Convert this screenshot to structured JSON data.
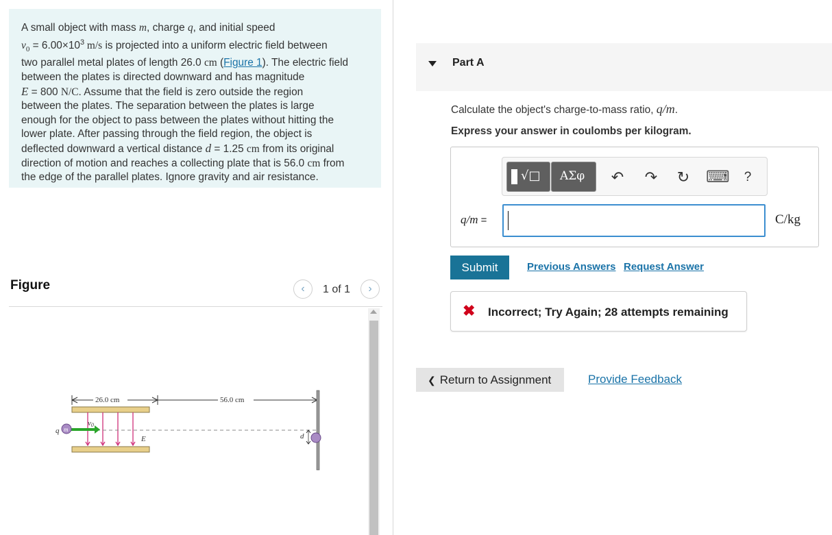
{
  "problem": {
    "line1_a": "A small object with mass ",
    "m": "m",
    "line1_b": ", charge ",
    "q": "q",
    "line1_c": ", and initial speed",
    "v0": "v",
    "v0_sub": "0",
    "line2_a": " = 6.00×10",
    "line2_exp": "3",
    "line2_unit": " m/s",
    "line2_b": " is projected into a uniform electric field between",
    "line3_a": "two parallel metal plates of length 26.0 ",
    "cm": "cm",
    "line3_b": " (",
    "figure_link": "Figure 1",
    "line3_c": "). The electric field",
    "line4": "between the plates is directed downward and has magnitude",
    "E": "E",
    "line5_a": " = 800 ",
    "line5_unit": "N/C",
    "line5_b": ". Assume that the field is zero outside the region",
    "line6": "between the plates. The separation between the plates is large",
    "line7": "enough for the object to pass between the plates without hitting the",
    "line8": "lower plate. After passing through the field region, the object is",
    "line9_a": "deflected downward a vertical distance ",
    "d": "d",
    "line9_b": " = 1.25 ",
    "line9_c": " from its original",
    "line10_a": "direction of motion and reaches a collecting plate that is 56.0 ",
    "line10_b": " from",
    "line11": "the edge of the parallel plates. Ignore gravity and air resistance."
  },
  "figure": {
    "title": "Figure",
    "prev_icon": "‹",
    "next_icon": "›",
    "pager": "1 of 1",
    "label_26": "26.0 cm",
    "label_56": "56.0 cm",
    "label_v0": "v",
    "label_v0_sub": "0",
    "label_q": "q",
    "label_m": "m",
    "label_E": "E",
    "label_d": "d"
  },
  "partA": {
    "label": "Part A",
    "question_a": "Calculate the object's charge-to-mass ratio, ",
    "question_b": ".",
    "qm": "q/m",
    "instruction": "Express your answer in coulombs per kilogram.",
    "toolbar": {
      "templates_icon": "√□",
      "greek_label": "ΑΣφ",
      "undo_icon": "↶",
      "redo_icon": "↷",
      "reset_icon": "↻",
      "keyboard_icon": "⌨",
      "help_label": "?"
    },
    "input_label": "q/m",
    "input_eq": " =",
    "input_value": "",
    "unit": "C/kg",
    "submit": "Submit",
    "previous_answers": "Previous Answers",
    "request_answer": "Request Answer",
    "feedback": "Incorrect; Try Again; 28 attempts remaining",
    "x_icon": "✖",
    "colors": {
      "accent": "#197397",
      "link": "#1a73a8",
      "error": "#d0021b",
      "problem_bg": "#e9f5f6"
    }
  },
  "footer": {
    "return_label": "Return to Assignment",
    "return_icon": "❮",
    "feedback_link": "Provide Feedback"
  }
}
